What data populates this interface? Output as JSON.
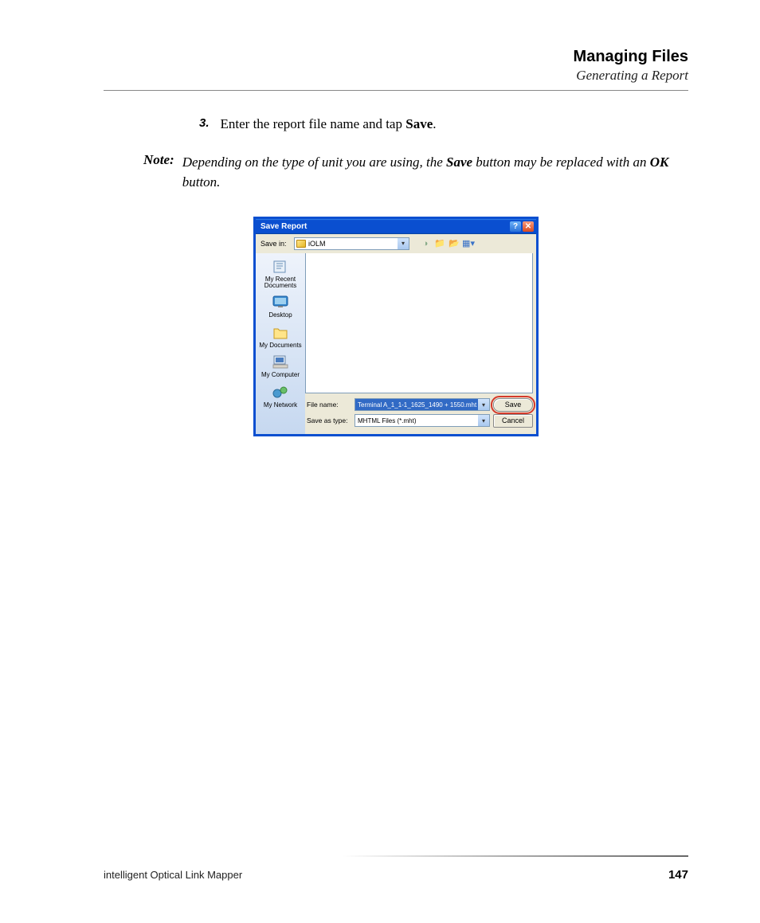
{
  "header": {
    "chapter": "Managing Files",
    "section": "Generating a Report"
  },
  "step": {
    "number": "3.",
    "text_before": "Enter the report file name and tap ",
    "bold_word": "Save",
    "text_after": "."
  },
  "note": {
    "label": "Note:",
    "t1": "Depending on the type of unit you are using, the ",
    "b1": "Save",
    "t2": " button may be replaced with an ",
    "b2": "OK",
    "t3": " button."
  },
  "dialog": {
    "title": "Save Report",
    "savein_label": "Save in:",
    "savein_value": "iOLM",
    "nav_icons": {
      "back": "back-icon",
      "up": "up-folder-icon",
      "new": "new-folder-icon",
      "view": "view-menu-icon"
    },
    "places": [
      {
        "label": "My Recent Documents",
        "icon": "recent-documents-icon"
      },
      {
        "label": "Desktop",
        "icon": "desktop-icon"
      },
      {
        "label": "My Documents",
        "icon": "my-documents-icon"
      },
      {
        "label": "My Computer",
        "icon": "my-computer-icon"
      },
      {
        "label": "My Network",
        "icon": "my-network-icon"
      }
    ],
    "filename_label": "File name:",
    "filename_value": "Terminal A_1_1-1_1625_1490 + 1550.mht",
    "savetype_label": "Save as type:",
    "savetype_value": "MHTML Files (*.mht)",
    "save_button": "Save",
    "cancel_button": "Cancel"
  },
  "footer": {
    "product": "intelligent Optical Link Mapper",
    "page": "147"
  }
}
